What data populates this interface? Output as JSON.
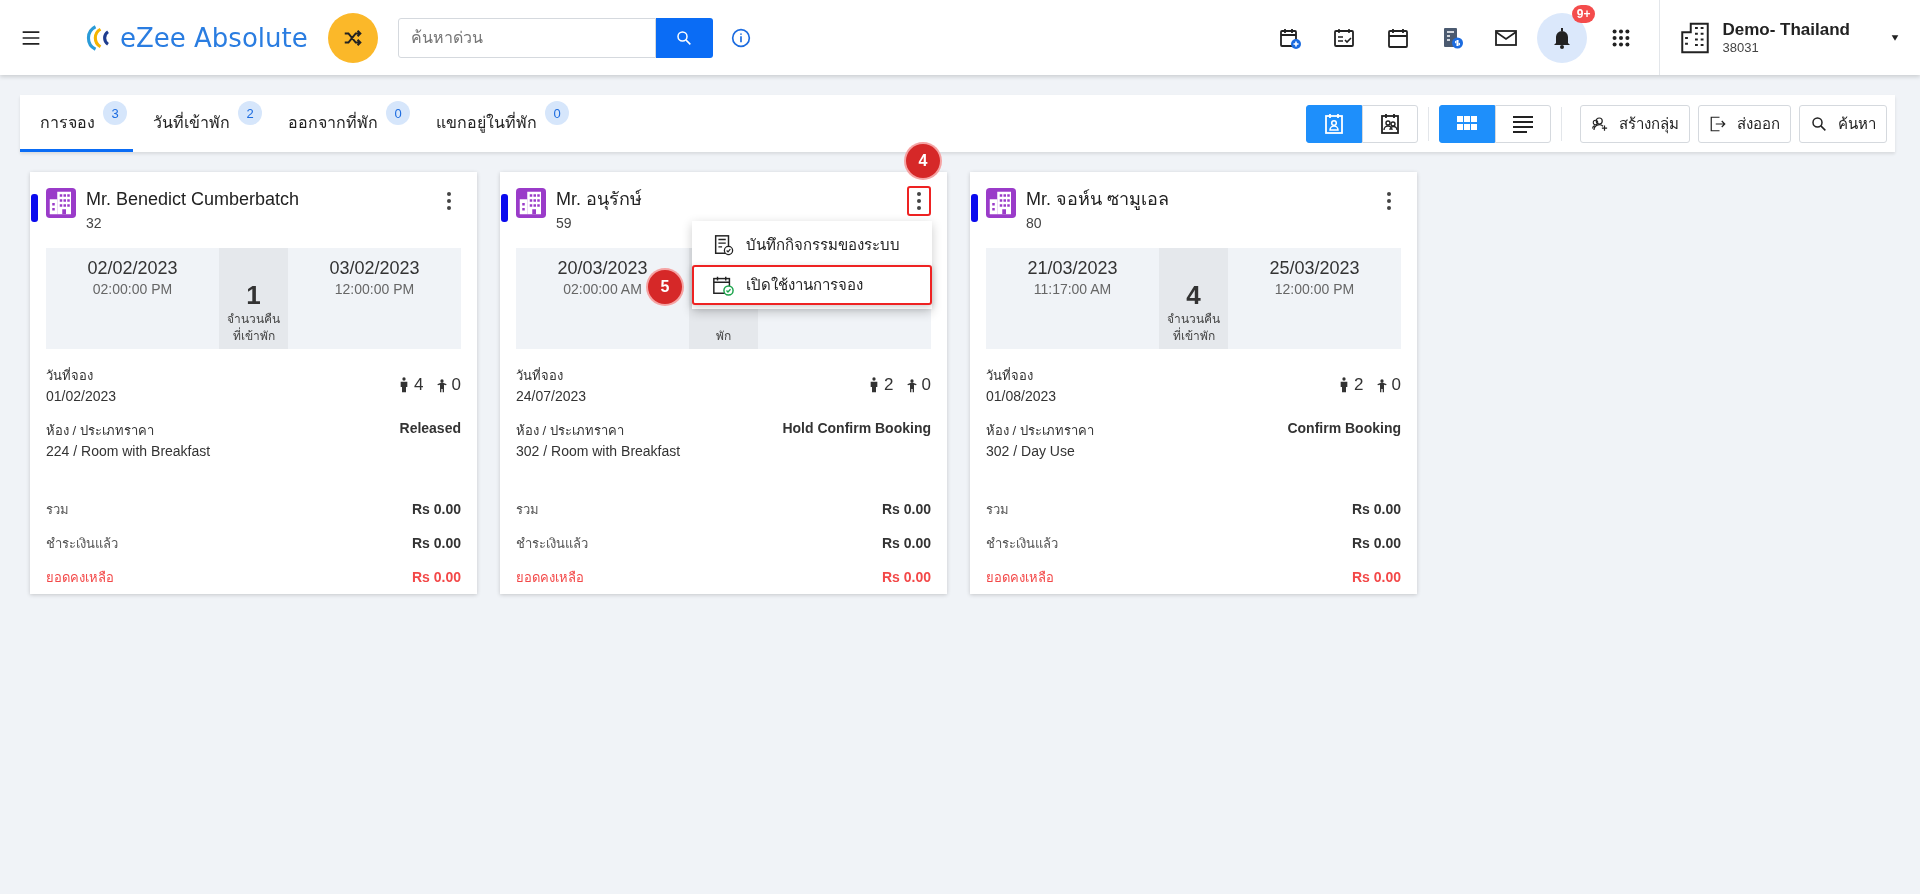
{
  "header": {
    "logo_text": "eZee Absolute",
    "search": {
      "placeholder": "ค้นหาด่วน"
    },
    "notification_badge": "9+",
    "property": {
      "name": "Demo- Thailand",
      "code": "38031"
    }
  },
  "tabs": [
    {
      "label": "การจอง",
      "count": "3",
      "selected": true
    },
    {
      "label": "วันที่เข้าพัก",
      "count": "2",
      "selected": false
    },
    {
      "label": "ออกจากที่พัก",
      "count": "0",
      "selected": false
    },
    {
      "label": "แขกอยู่ในที่พัก",
      "count": "0",
      "selected": false
    }
  ],
  "view_modes": [
    {
      "kind": "arrival",
      "selected": true
    },
    {
      "kind": "inhouse",
      "selected": false
    }
  ],
  "layouts": [
    {
      "kind": "grid",
      "selected": true
    },
    {
      "kind": "list",
      "selected": false
    }
  ],
  "actions": [
    {
      "kind": "group",
      "label": "สร้างกลุ่ม"
    },
    {
      "kind": "export",
      "label": "ส่งออก"
    },
    {
      "kind": "search",
      "label": "ค้นหา"
    }
  ],
  "bookings": [
    {
      "name": "Mr. Benedict Cumberbatch",
      "number": "32",
      "menu_highlighted": false,
      "check_in": {
        "date": "02/02/2023",
        "time": "02:00:00 PM"
      },
      "nights": "1",
      "nights_label": "จำนวนคืนที่เข้าพัก",
      "check_out": {
        "date": "03/02/2023",
        "time": "12:00:00 PM"
      },
      "booking_date_label": "วันที่จอง",
      "booking_date": "01/02/2023",
      "adults": "4",
      "children": "0",
      "room_label": "ห้อง / ประเภทราคา",
      "room": "224 / Room with Breakfast",
      "status": "Released",
      "totals": [
        {
          "kind": "total",
          "label": "รวม",
          "value": "Rs 0.00"
        },
        {
          "kind": "paid",
          "label": "ชำระเงินแล้ว",
          "value": "Rs 0.00"
        },
        {
          "kind": "balance",
          "label": "ยอดคงเหลือ",
          "value": "Rs 0.00"
        }
      ]
    },
    {
      "name": "Mr. อนุรักษ์",
      "number": "59",
      "menu_highlighted": true,
      "check_in": {
        "date": "20/03/2023",
        "time": "02:00:00 AM"
      },
      "nights_label": "พัก",
      "booking_date_label": "วันที่จอง",
      "booking_date": "24/07/2023",
      "adults": "2",
      "children": "0",
      "room_label": "ห้อง / ประเภทราคา",
      "room": "302 / Room with Breakfast",
      "status": "Hold Confirm Booking",
      "totals": [
        {
          "kind": "total",
          "label": "รวม",
          "value": "Rs 0.00"
        },
        {
          "kind": "paid",
          "label": "ชำระเงินแล้ว",
          "value": "Rs 0.00"
        },
        {
          "kind": "balance",
          "label": "ยอดคงเหลือ",
          "value": "Rs 0.00"
        }
      ],
      "menu": [
        {
          "kind": "log",
          "label": "บันทึกกิจกรรมของระบบ",
          "highlighted": false
        },
        {
          "kind": "activate",
          "label": "เปิดใช้งานการจอง",
          "highlighted": true
        }
      ]
    },
    {
      "name": "Mr. จอห์น ซามูเอล",
      "number": "80",
      "menu_highlighted": false,
      "check_in": {
        "date": "21/03/2023",
        "time": "11:17:00 AM"
      },
      "nights": "4",
      "nights_label": "จำนวนคืนที่เข้าพัก",
      "check_out": {
        "date": "25/03/2023",
        "time": "12:00:00 PM"
      },
      "booking_date_label": "วันที่จอง",
      "booking_date": "01/08/2023",
      "adults": "2",
      "children": "0",
      "room_label": "ห้อง / ประเภทราคา",
      "room": "302 / Day Use",
      "status": "Confirm Booking",
      "totals": [
        {
          "kind": "total",
          "label": "รวม",
          "value": "Rs 0.00"
        },
        {
          "kind": "paid",
          "label": "ชำระเงินแล้ว",
          "value": "Rs 0.00"
        },
        {
          "kind": "balance",
          "label": "ยอดคงเหลือ",
          "value": "Rs 0.00"
        }
      ]
    }
  ],
  "annotations": [
    {
      "label": "4"
    },
    {
      "label": "5"
    }
  ]
}
